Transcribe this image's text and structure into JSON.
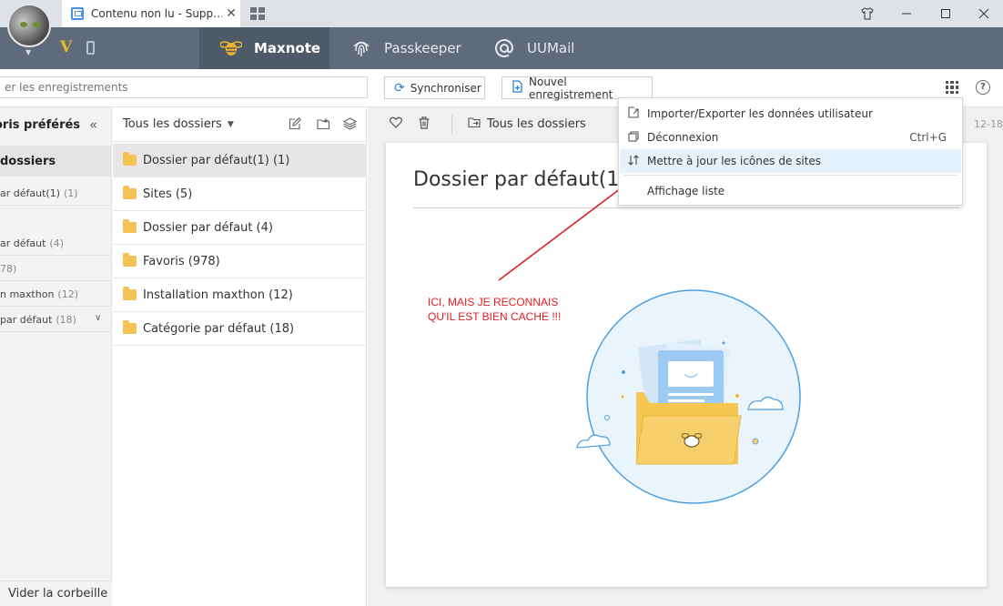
{
  "browser": {
    "tab_title": "Contenu non lu - Supp…",
    "tab_close": "✕",
    "window_buttons": [
      "shirt-icon",
      "minimize-icon",
      "maximize-icon",
      "close-icon"
    ]
  },
  "app_bar": {
    "vip_label": "V",
    "tabs": [
      {
        "label": "Maxnote",
        "icon": "bee-icon",
        "active": true
      },
      {
        "label": "Passkeeper",
        "icon": "fingerprint-icon",
        "active": false
      },
      {
        "label": "UUMail",
        "icon": "at-icon",
        "active": false
      }
    ]
  },
  "toolbar": {
    "search_placeholder": "er les enregistrements",
    "sync_label": "Synchroniser",
    "new_record_label": "Nouvel enregistrement"
  },
  "sidebar": {
    "header": "oris préférés",
    "all_folders": "dossiers",
    "items": [
      {
        "label": "ar défaut(1)",
        "count": "(1)"
      },
      {
        "label": "ar défaut",
        "count": "(4)"
      },
      {
        "label": "78)",
        "count": ""
      },
      {
        "label": "n maxthon",
        "count": "(12)"
      },
      {
        "label": "par défaut",
        "count": "(18)"
      }
    ],
    "footer": "Vider la corbeille"
  },
  "folder_list": {
    "header": "Tous les dossiers",
    "folders": [
      {
        "label": "Dossier par défaut(1) (1)",
        "selected": true
      },
      {
        "label": "Sites (5)",
        "selected": false
      },
      {
        "label": "Dossier par défaut (4)",
        "selected": false
      },
      {
        "label": "Favoris (978)",
        "selected": false
      },
      {
        "label": "Installation maxthon (12)",
        "selected": false
      },
      {
        "label": "Catégorie par défaut (18)",
        "selected": false
      }
    ]
  },
  "note": {
    "folder_label": "Tous les dossiers",
    "date": "12-18",
    "title": "Dossier par défaut(1)"
  },
  "menu": {
    "items": [
      {
        "label": "Importer/Exporter les données utilisateur",
        "shortcut": "",
        "icon": "import-export-icon"
      },
      {
        "label": "Déconnexion",
        "shortcut": "Ctrl+G",
        "icon": "logout-icon"
      },
      {
        "label": "Mettre à jour les icônes de sites",
        "shortcut": "",
        "icon": "update-arrows-icon"
      },
      {
        "label": "Affichage liste",
        "shortcut": "",
        "icon": ""
      }
    ]
  },
  "annotation": {
    "line1": "ICI, MAIS JE RECONNAIS",
    "line2": "QU'IL EST BIEN CACHE !!!"
  },
  "colors": {
    "accent": "#2a7fd4",
    "app_bar": "#5f6b7a",
    "folder": "#f5c255",
    "annotation": "#e02020"
  }
}
